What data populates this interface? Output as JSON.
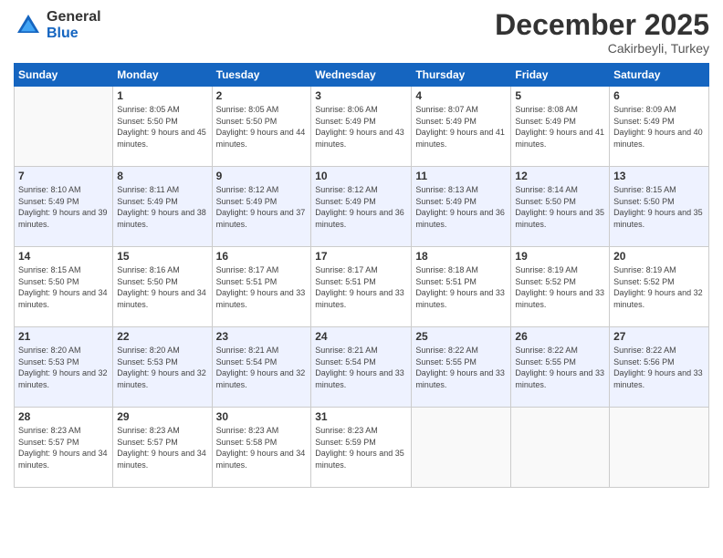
{
  "logo": {
    "general": "General",
    "blue": "Blue"
  },
  "title": "December 2025",
  "subtitle": "Cakirbeyli, Turkey",
  "days_of_week": [
    "Sunday",
    "Monday",
    "Tuesday",
    "Wednesday",
    "Thursday",
    "Friday",
    "Saturday"
  ],
  "weeks": [
    [
      {
        "day": "",
        "sunrise": "",
        "sunset": "",
        "daylight": ""
      },
      {
        "day": "1",
        "sunrise": "Sunrise: 8:05 AM",
        "sunset": "Sunset: 5:50 PM",
        "daylight": "Daylight: 9 hours and 45 minutes."
      },
      {
        "day": "2",
        "sunrise": "Sunrise: 8:05 AM",
        "sunset": "Sunset: 5:50 PM",
        "daylight": "Daylight: 9 hours and 44 minutes."
      },
      {
        "day": "3",
        "sunrise": "Sunrise: 8:06 AM",
        "sunset": "Sunset: 5:49 PM",
        "daylight": "Daylight: 9 hours and 43 minutes."
      },
      {
        "day": "4",
        "sunrise": "Sunrise: 8:07 AM",
        "sunset": "Sunset: 5:49 PM",
        "daylight": "Daylight: 9 hours and 41 minutes."
      },
      {
        "day": "5",
        "sunrise": "Sunrise: 8:08 AM",
        "sunset": "Sunset: 5:49 PM",
        "daylight": "Daylight: 9 hours and 41 minutes."
      },
      {
        "day": "6",
        "sunrise": "Sunrise: 8:09 AM",
        "sunset": "Sunset: 5:49 PM",
        "daylight": "Daylight: 9 hours and 40 minutes."
      }
    ],
    [
      {
        "day": "7",
        "sunrise": "Sunrise: 8:10 AM",
        "sunset": "Sunset: 5:49 PM",
        "daylight": "Daylight: 9 hours and 39 minutes."
      },
      {
        "day": "8",
        "sunrise": "Sunrise: 8:11 AM",
        "sunset": "Sunset: 5:49 PM",
        "daylight": "Daylight: 9 hours and 38 minutes."
      },
      {
        "day": "9",
        "sunrise": "Sunrise: 8:12 AM",
        "sunset": "Sunset: 5:49 PM",
        "daylight": "Daylight: 9 hours and 37 minutes."
      },
      {
        "day": "10",
        "sunrise": "Sunrise: 8:12 AM",
        "sunset": "Sunset: 5:49 PM",
        "daylight": "Daylight: 9 hours and 36 minutes."
      },
      {
        "day": "11",
        "sunrise": "Sunrise: 8:13 AM",
        "sunset": "Sunset: 5:49 PM",
        "daylight": "Daylight: 9 hours and 36 minutes."
      },
      {
        "day": "12",
        "sunrise": "Sunrise: 8:14 AM",
        "sunset": "Sunset: 5:50 PM",
        "daylight": "Daylight: 9 hours and 35 minutes."
      },
      {
        "day": "13",
        "sunrise": "Sunrise: 8:15 AM",
        "sunset": "Sunset: 5:50 PM",
        "daylight": "Daylight: 9 hours and 35 minutes."
      }
    ],
    [
      {
        "day": "14",
        "sunrise": "Sunrise: 8:15 AM",
        "sunset": "Sunset: 5:50 PM",
        "daylight": "Daylight: 9 hours and 34 minutes."
      },
      {
        "day": "15",
        "sunrise": "Sunrise: 8:16 AM",
        "sunset": "Sunset: 5:50 PM",
        "daylight": "Daylight: 9 hours and 34 minutes."
      },
      {
        "day": "16",
        "sunrise": "Sunrise: 8:17 AM",
        "sunset": "Sunset: 5:51 PM",
        "daylight": "Daylight: 9 hours and 33 minutes."
      },
      {
        "day": "17",
        "sunrise": "Sunrise: 8:17 AM",
        "sunset": "Sunset: 5:51 PM",
        "daylight": "Daylight: 9 hours and 33 minutes."
      },
      {
        "day": "18",
        "sunrise": "Sunrise: 8:18 AM",
        "sunset": "Sunset: 5:51 PM",
        "daylight": "Daylight: 9 hours and 33 minutes."
      },
      {
        "day": "19",
        "sunrise": "Sunrise: 8:19 AM",
        "sunset": "Sunset: 5:52 PM",
        "daylight": "Daylight: 9 hours and 33 minutes."
      },
      {
        "day": "20",
        "sunrise": "Sunrise: 8:19 AM",
        "sunset": "Sunset: 5:52 PM",
        "daylight": "Daylight: 9 hours and 32 minutes."
      }
    ],
    [
      {
        "day": "21",
        "sunrise": "Sunrise: 8:20 AM",
        "sunset": "Sunset: 5:53 PM",
        "daylight": "Daylight: 9 hours and 32 minutes."
      },
      {
        "day": "22",
        "sunrise": "Sunrise: 8:20 AM",
        "sunset": "Sunset: 5:53 PM",
        "daylight": "Daylight: 9 hours and 32 minutes."
      },
      {
        "day": "23",
        "sunrise": "Sunrise: 8:21 AM",
        "sunset": "Sunset: 5:54 PM",
        "daylight": "Daylight: 9 hours and 32 minutes."
      },
      {
        "day": "24",
        "sunrise": "Sunrise: 8:21 AM",
        "sunset": "Sunset: 5:54 PM",
        "daylight": "Daylight: 9 hours and 33 minutes."
      },
      {
        "day": "25",
        "sunrise": "Sunrise: 8:22 AM",
        "sunset": "Sunset: 5:55 PM",
        "daylight": "Daylight: 9 hours and 33 minutes."
      },
      {
        "day": "26",
        "sunrise": "Sunrise: 8:22 AM",
        "sunset": "Sunset: 5:55 PM",
        "daylight": "Daylight: 9 hours and 33 minutes."
      },
      {
        "day": "27",
        "sunrise": "Sunrise: 8:22 AM",
        "sunset": "Sunset: 5:56 PM",
        "daylight": "Daylight: 9 hours and 33 minutes."
      }
    ],
    [
      {
        "day": "28",
        "sunrise": "Sunrise: 8:23 AM",
        "sunset": "Sunset: 5:57 PM",
        "daylight": "Daylight: 9 hours and 34 minutes."
      },
      {
        "day": "29",
        "sunrise": "Sunrise: 8:23 AM",
        "sunset": "Sunset: 5:57 PM",
        "daylight": "Daylight: 9 hours and 34 minutes."
      },
      {
        "day": "30",
        "sunrise": "Sunrise: 8:23 AM",
        "sunset": "Sunset: 5:58 PM",
        "daylight": "Daylight: 9 hours and 34 minutes."
      },
      {
        "day": "31",
        "sunrise": "Sunrise: 8:23 AM",
        "sunset": "Sunset: 5:59 PM",
        "daylight": "Daylight: 9 hours and 35 minutes."
      },
      {
        "day": "",
        "sunrise": "",
        "sunset": "",
        "daylight": ""
      },
      {
        "day": "",
        "sunrise": "",
        "sunset": "",
        "daylight": ""
      },
      {
        "day": "",
        "sunrise": "",
        "sunset": "",
        "daylight": ""
      }
    ]
  ]
}
